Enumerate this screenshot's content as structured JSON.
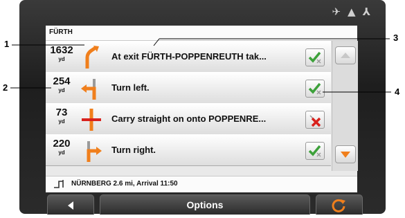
{
  "header": {
    "location": "FÜRTH"
  },
  "route_rows": [
    {
      "distance": "1632",
      "unit": "yd",
      "instruction": "At exit FÜRTH-POPPENREUTH tak...",
      "turn": "exit-right-icon",
      "status": "included"
    },
    {
      "distance": "254",
      "unit": "yd",
      "instruction": "Turn left.",
      "turn": "turn-left-icon",
      "status": "included"
    },
    {
      "distance": "73",
      "unit": "yd",
      "instruction": "Carry straight on onto POPPENRE...",
      "turn": "straight-icon",
      "status": "excluded"
    },
    {
      "distance": "220",
      "unit": "yd",
      "instruction": "Turn right.",
      "turn": "turn-right-icon",
      "status": "included"
    }
  ],
  "footer": {
    "destination_info": "NÜRNBERG 2.6 mi, Arrival 11:50"
  },
  "buttons": {
    "options_label": "Options"
  },
  "callouts": [
    "1",
    "2",
    "3",
    "4"
  ],
  "colors": {
    "turn_arrow": "#f07f1c",
    "check_green": "#3da13a",
    "cross_red": "#d8211c"
  }
}
